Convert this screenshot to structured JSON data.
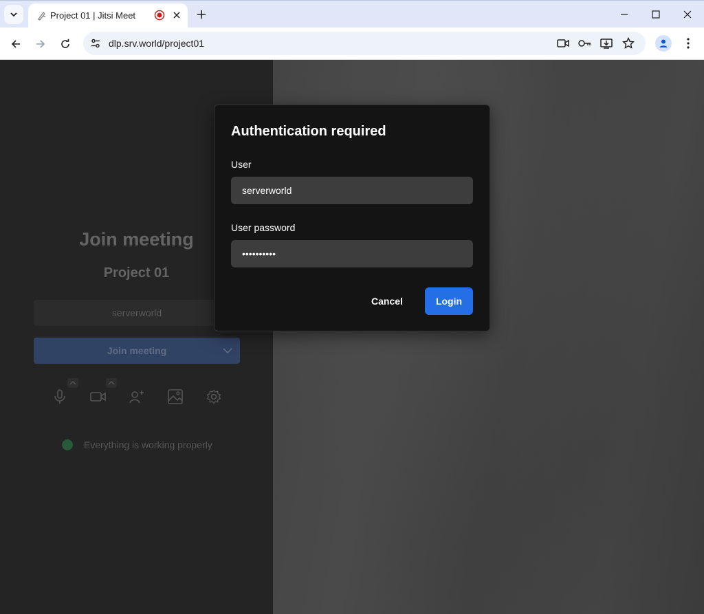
{
  "browser": {
    "tab_title": "Project 01 | Jitsi Meet",
    "url": "dlp.srv.world/project01"
  },
  "prejoin": {
    "title": "Join meeting",
    "room_name": "Project 01",
    "name_value": "serverworld",
    "join_label": "Join meeting",
    "status_text": "Everything is working properly"
  },
  "dialog": {
    "title": "Authentication required",
    "user_label": "User",
    "user_value": "serverworld",
    "password_label": "User password",
    "password_value": "••••••••••",
    "cancel_label": "Cancel",
    "login_label": "Login"
  },
  "colors": {
    "login_button": "#246fe5",
    "dialog_bg": "#141414",
    "prejoin_bg": "#262626"
  }
}
